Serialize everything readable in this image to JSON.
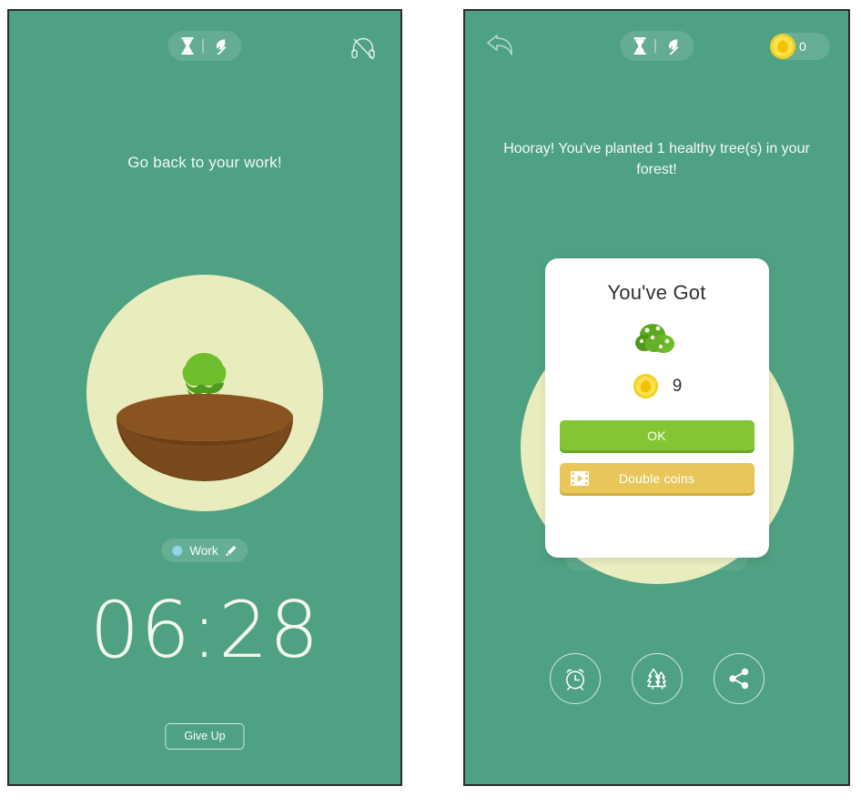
{
  "app": {
    "background_color": "#4fa183",
    "accent_green": "#83c533",
    "accent_yellow": "#e8c659",
    "coin_color": "#f2d024",
    "halo_color": "#e9edbd",
    "soil_color": "#7a4a1f"
  },
  "left_panel": {
    "topbar": {
      "mode_pill": {
        "hourglass_icon": "hourglass-icon",
        "separator": "|",
        "plant_off_icon": "plant-disabled-icon"
      },
      "headphone_icon": "headphones-off-icon"
    },
    "hint": "Go back to your work!",
    "plant": {
      "halo_icon": "halo-circle",
      "soil_icon": "soil-bowl-icon",
      "sapling_icon": "sapling-icon"
    },
    "tag": {
      "dot_color": "#8fd6e6",
      "label": "Work",
      "edit_icon": "pencil-edit-icon"
    },
    "timer": "06:28",
    "give_up_label": "Give Up"
  },
  "right_panel": {
    "topbar": {
      "back_icon": "back-arrow-icon",
      "mode_pill": {
        "hourglass_icon": "hourglass-icon",
        "separator": "|",
        "plant_off_icon": "plant-disabled-icon"
      },
      "coin_badge": {
        "coin_icon": "coin-icon",
        "amount": "0"
      }
    },
    "hooray": "Hooray! You've planted 1 healthy tree(s) in your forest!",
    "reward_card": {
      "title": "You've Got",
      "bush_icon": "flowering-bush-icon",
      "coin_icon": "coin-icon",
      "coin_count": "9",
      "ok_label": "OK",
      "double_coins_label": "Double coins",
      "double_coins_icon": "video-ad-icon"
    },
    "actions": [
      {
        "name": "alarm-clock",
        "icon": "alarm-clock-icon"
      },
      {
        "name": "forest",
        "icon": "forest-trees-icon"
      },
      {
        "name": "share",
        "icon": "share-icon"
      }
    ]
  }
}
